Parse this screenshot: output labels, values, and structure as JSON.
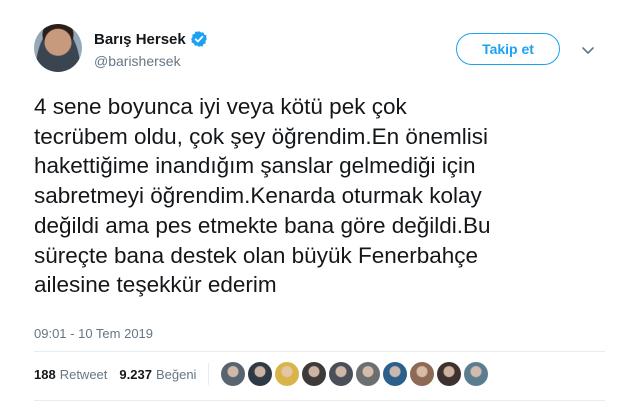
{
  "user": {
    "name": "Barış Hersek",
    "handle": "@barishersek",
    "verified": true
  },
  "actions": {
    "follow_label": "Takip et"
  },
  "tweet": {
    "text": "4 sene boyunca iyi veya kötü pek çok\ntecrübem oldu, çok şey öğrendim.En önemlisi\nhakettiğime inandığım şanslar gelmediği için\nsabretmeyi öğrendim.Kenarda oturmak kolay\ndeğildi ama pes etmekte bana göre değildi.Bu\nsüreçte bana destek olan büyük Fenerbahçe\nailesine teşekkür ederim",
    "timestamp": "09:01 - 10 Tem 2019"
  },
  "stats": {
    "retweets_count": "188",
    "retweets_label": "Retweet",
    "likes_count": "9.237",
    "likes_label": "Beğeni"
  },
  "likers": [
    {
      "name": "liker-avatar-1",
      "color": "#5a6470"
    },
    {
      "name": "liker-avatar-2",
      "color": "#2f3a44"
    },
    {
      "name": "liker-avatar-3",
      "color": "#d9b44a"
    },
    {
      "name": "liker-avatar-4",
      "color": "#3c3a3a"
    },
    {
      "name": "liker-avatar-5",
      "color": "#4a4f5a"
    },
    {
      "name": "liker-avatar-6",
      "color": "#6b6f70"
    },
    {
      "name": "liker-avatar-7",
      "color": "#2c5f8a"
    },
    {
      "name": "liker-avatar-8",
      "color": "#8c6a55"
    },
    {
      "name": "liker-avatar-9",
      "color": "#3e3230"
    },
    {
      "name": "liker-avatar-10",
      "color": "#5b7d8f"
    }
  ],
  "colors": {
    "accent": "#1da1f2",
    "secondary_text": "#657786",
    "divider": "#e6ecf0"
  }
}
